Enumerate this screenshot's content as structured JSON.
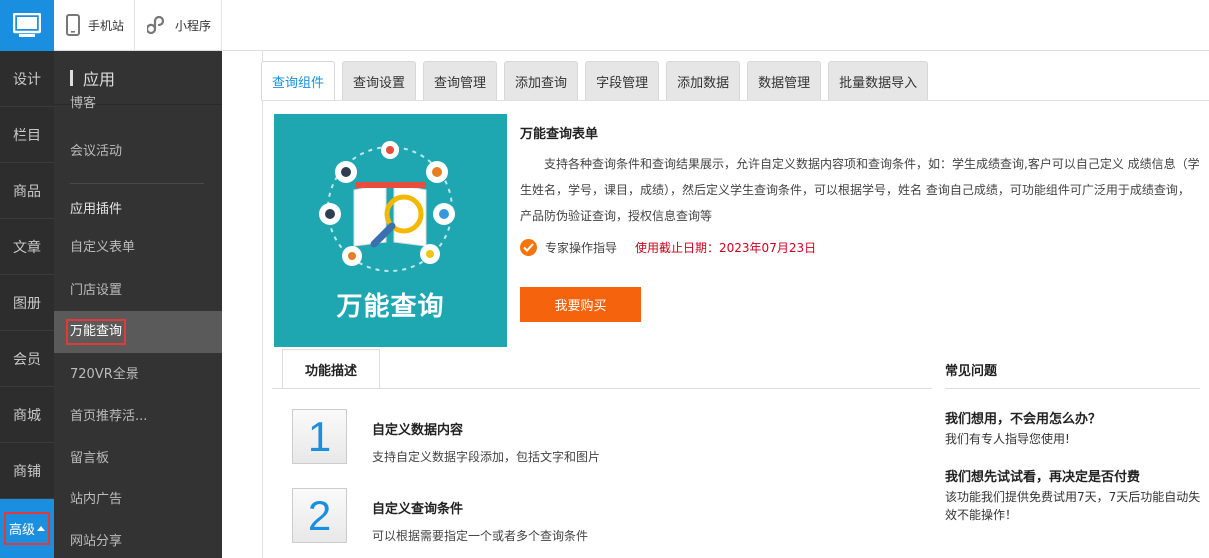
{
  "rail": {
    "items": [
      "设计",
      "栏目",
      "商品",
      "文章",
      "图册",
      "会员",
      "商城",
      "商铺"
    ],
    "advanced": "高级"
  },
  "topbar": {
    "mobile": "手机站",
    "miniprogram": "小程序"
  },
  "sidebar": {
    "heading": "应用",
    "items": {
      "blog": "博客",
      "meeting": "会议活动",
      "plugins_section": "应用插件",
      "custom_form": "自定义表单",
      "store_settings": "门店设置",
      "universal_query": "万能查询",
      "vr": "720VR全景",
      "homepage_recommend": "首页推荐活...",
      "guestbook": "留言板",
      "site_ads": "站内广告",
      "site_share": "网站分享"
    }
  },
  "tabs": [
    "查询组件",
    "查询设置",
    "查询管理",
    "添加查询",
    "字段管理",
    "添加数据",
    "数据管理",
    "批量数据导入"
  ],
  "product": {
    "hero_text": "万能查询",
    "title": "万能查询表单",
    "description": "支持各种查询条件和查询结果展示，允许自定义数据内容项和查询条件，如：学生成绩查询,客户可以自己定义 成绩信息（学生姓名，学号，课目，成绩），然后定义学生查询条件，可以根据学号，姓名 查询自己成绩，可功能组件可广泛用于成绩查询，产品防伪验证查询，授权信息查询等",
    "guide": "专家操作指导",
    "deadline": "使用截止日期：2023年07月23日",
    "buy_button": "我要购买"
  },
  "features": {
    "tab": "功能描述",
    "items": [
      {
        "num": "1",
        "title": "自定义数据内容",
        "desc": "支持自定义数据字段添加，包括文字和图片"
      },
      {
        "num": "2",
        "title": "自定义查询条件",
        "desc": "可以根据需要指定一个或者多个查询条件"
      }
    ]
  },
  "faq": {
    "heading": "常见问题",
    "items": [
      {
        "q": "我们想用，不会用怎么办？",
        "a": "我们有专人指导您使用!"
      },
      {
        "q": "我们想先试试看，再决定是否付费",
        "a": "该功能我们提供免费试用7天，7天后功能自动失效不能操作！"
      }
    ]
  },
  "colors": {
    "brand_blue": "#1a8fe0",
    "buy_orange": "#f5640c",
    "deadline_red": "#d0021b",
    "hero_teal": "#1fa7b1"
  }
}
